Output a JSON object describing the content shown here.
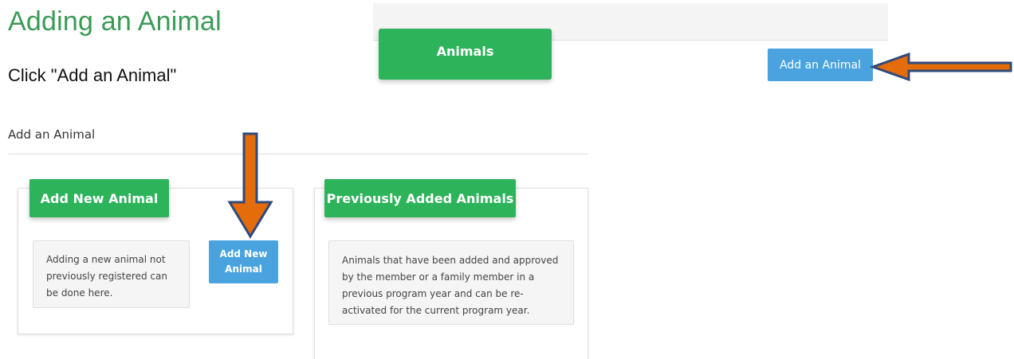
{
  "slide": {
    "title": "Adding an Animal",
    "instruction": "Click \"Add an Animal\""
  },
  "top_screenshot": {
    "animals_tab_label": "Animals",
    "add_animal_button": "Add an Animal"
  },
  "add_page": {
    "heading": "Add an Animal",
    "new_panel": {
      "header": "Add New Animal",
      "description": "Adding a new animal not previously registered can be done here.",
      "button_line1": "Add New",
      "button_line2": "Animal"
    },
    "previous_panel": {
      "header": "Previously Added Animals",
      "description": "Animals that have been added and approved by the member or a family member in a previous program year and can be re-activated for the current program year."
    }
  },
  "annotations": {
    "arrow_fill": "#e46c0a",
    "arrow_outline": "#2f4a7a"
  },
  "colors": {
    "title_green": "#3a9a56",
    "header_green": "#2db35a",
    "button_blue": "#4aa3df"
  }
}
